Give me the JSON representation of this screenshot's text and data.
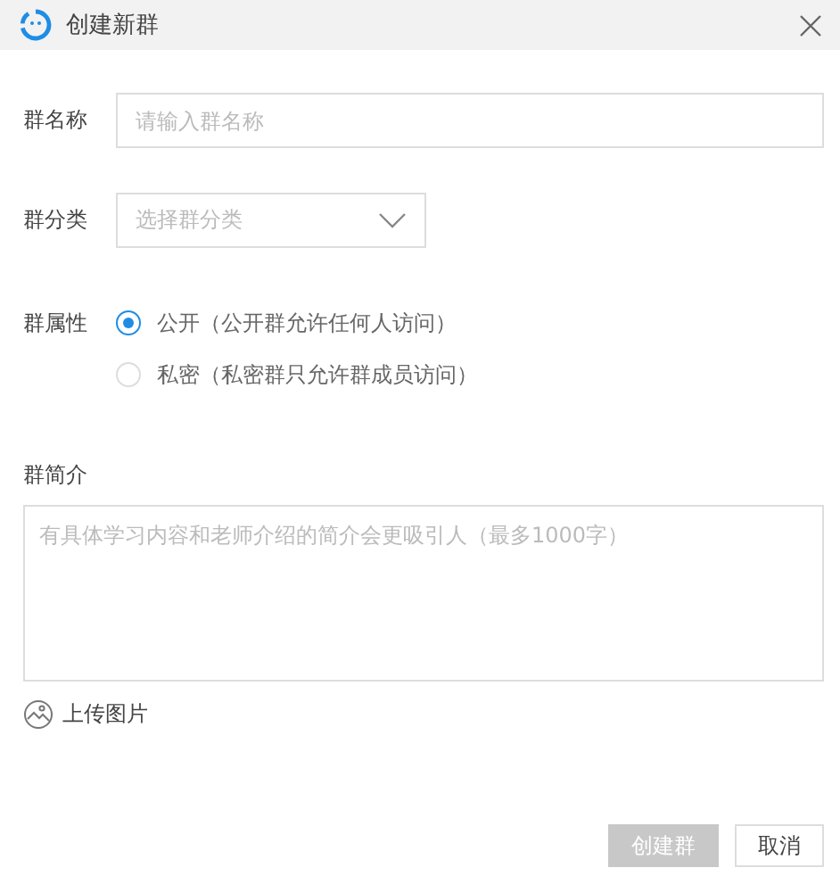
{
  "window": {
    "title": "创建新群"
  },
  "name_field": {
    "label": "群名称",
    "placeholder": "请输入群名称"
  },
  "category_field": {
    "label": "群分类",
    "placeholder": "选择群分类"
  },
  "privacy": {
    "label": "群属性",
    "options": [
      {
        "title": "公开",
        "hint": "（公开群允许任何人访问）",
        "selected": true
      },
      {
        "title": "私密",
        "hint": "（私密群只允许群成员访问）",
        "selected": false
      }
    ]
  },
  "intro": {
    "label": "群简介",
    "placeholder": "有具体学习内容和老师介绍的简介会更吸引人（最多1000字）"
  },
  "upload": {
    "label": "上传图片"
  },
  "buttons": [
    {
      "label": "创建群",
      "kind": "primary",
      "disabled": true
    },
    {
      "label": "取消",
      "kind": "secondary",
      "disabled": false
    }
  ]
}
